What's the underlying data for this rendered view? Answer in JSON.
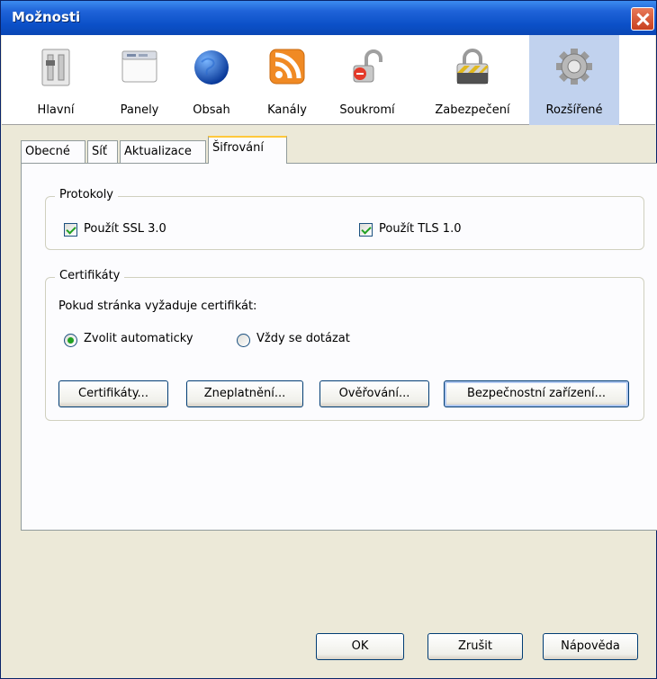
{
  "window": {
    "title": "Možnosti"
  },
  "toolbar": {
    "items": [
      {
        "label": "Hlavní",
        "icon": "general-switch-icon"
      },
      {
        "label": "Panely",
        "icon": "tabs-window-icon"
      },
      {
        "label": "Obsah",
        "icon": "globe-icon"
      },
      {
        "label": "Kanály",
        "icon": "rss-feed-icon"
      },
      {
        "label": "Soukromí",
        "icon": "privacy-lock-icon"
      },
      {
        "label": "Zabezpečení",
        "icon": "security-padlock-icon"
      },
      {
        "label": "Rozšířené",
        "icon": "gear-icon"
      }
    ],
    "selected": "Rozšířené"
  },
  "tabs": [
    "Obecné",
    "Síť",
    "Aktualizace",
    "Šifrování"
  ],
  "active_tab": "Šifrování",
  "protocols": {
    "legend": "Protokoly",
    "ssl": {
      "label": "Použít SSL 3.0",
      "checked": true
    },
    "tls": {
      "label": "Použít TLS 1.0",
      "checked": true
    }
  },
  "certificates": {
    "legend": "Certifikáty",
    "prompt": "Pokud stránka vyžaduje certifikát:",
    "auto": {
      "label": "Zvolit automaticky",
      "selected": true
    },
    "ask": {
      "label": "Vždy se dotázat",
      "selected": false
    },
    "buttons": {
      "certs": "Certifikáty...",
      "revocation": "Zneplatnění...",
      "verification": "Ověřování...",
      "devices": "Bezpečnostní zařízení..."
    }
  },
  "footer": {
    "ok": "OK",
    "cancel": "Zrušit",
    "help": "Nápověda"
  }
}
